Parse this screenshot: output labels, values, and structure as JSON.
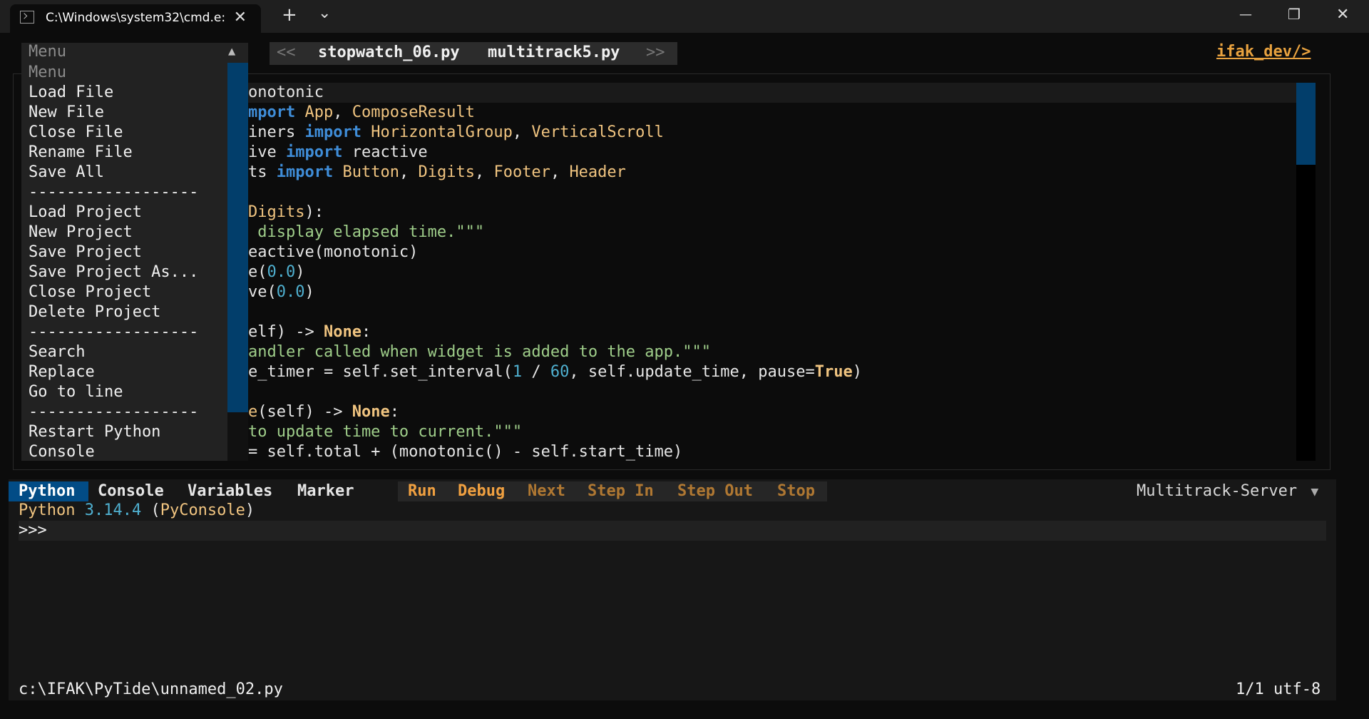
{
  "window": {
    "tab_title": "C:\\Windows\\system32\\cmd.e:",
    "tab_close": "✕",
    "new_tab": "+",
    "dropdown": "⌄",
    "minimize": "—",
    "restore": "❐",
    "close": "✕"
  },
  "menu": {
    "header": "Menu",
    "scroll_up": "▲",
    "items": [
      {
        "label": "Menu",
        "dim": true
      },
      {
        "label": "Load File"
      },
      {
        "label": "New File"
      },
      {
        "label": "Close File"
      },
      {
        "label": "Rename File"
      },
      {
        "label": "Save All"
      },
      {
        "label": "------------------"
      },
      {
        "label": "Load Project"
      },
      {
        "label": "New Project"
      },
      {
        "label": "Save Project"
      },
      {
        "label": "Save Project As..."
      },
      {
        "label": "Close Project"
      },
      {
        "label": "Delete Project"
      },
      {
        "label": "------------------"
      },
      {
        "label": "Search"
      },
      {
        "label": "Replace"
      },
      {
        "label": "Go to line"
      },
      {
        "label": "------------------"
      },
      {
        "label": "Restart Python"
      },
      {
        "label": "Console"
      }
    ]
  },
  "file_tabs": {
    "prev": "<<",
    "tabs": [
      "stopwatch_06.py",
      "multitrack5.py"
    ],
    "next": ">>"
  },
  "brand": "ifak_dev/>",
  "editor": {
    "lines": [
      [
        [
          "onotonic",
          ""
        ]
      ],
      [
        [
          "mport",
          "kw"
        ],
        [
          " ",
          ""
        ],
        [
          "App",
          "cls"
        ],
        [
          ", ",
          ""
        ],
        [
          "ComposeResult",
          "cls"
        ]
      ],
      [
        [
          "iners ",
          ""
        ],
        [
          "import",
          "kw"
        ],
        [
          " ",
          ""
        ],
        [
          "HorizontalGroup",
          "cls"
        ],
        [
          ", ",
          ""
        ],
        [
          "VerticalScroll",
          "cls"
        ]
      ],
      [
        [
          "ive ",
          ""
        ],
        [
          "import",
          "kw"
        ],
        [
          " reactive",
          ""
        ]
      ],
      [
        [
          "ts ",
          ""
        ],
        [
          "import",
          "kw"
        ],
        [
          " ",
          ""
        ],
        [
          "Button",
          "cls"
        ],
        [
          ", ",
          ""
        ],
        [
          "Digits",
          "cls"
        ],
        [
          ", ",
          ""
        ],
        [
          "Footer",
          "cls"
        ],
        [
          ", ",
          ""
        ],
        [
          "Header",
          "cls"
        ]
      ],
      [
        [
          "",
          ""
        ]
      ],
      [
        [
          "Digits",
          "cls"
        ],
        [
          "):",
          ""
        ]
      ],
      [
        [
          " display elapsed time.\"\"\"",
          "str"
        ]
      ],
      [
        [
          "eactive(monotonic)",
          ""
        ]
      ],
      [
        [
          "e(",
          ""
        ],
        [
          "0.0",
          "num"
        ],
        [
          ")",
          ""
        ]
      ],
      [
        [
          "ve(",
          ""
        ],
        [
          "0.0",
          "num"
        ],
        [
          ")",
          ""
        ]
      ],
      [
        [
          "",
          ""
        ]
      ],
      [
        [
          "elf) -> ",
          ""
        ],
        [
          "None",
          "kc"
        ],
        [
          ":",
          ""
        ]
      ],
      [
        [
          "andler called when widget is added to the app.\"\"\"",
          "str"
        ]
      ],
      [
        [
          "e_timer = self.set_interval(",
          ""
        ],
        [
          "1",
          "num"
        ],
        [
          " / ",
          ""
        ],
        [
          "60",
          "num"
        ],
        [
          ", self.update_time, pause=",
          ""
        ],
        [
          "True",
          "kc"
        ],
        [
          ")",
          ""
        ]
      ],
      [
        [
          "",
          ""
        ]
      ],
      [
        [
          "e",
          "cls"
        ],
        [
          "(self) -> ",
          ""
        ],
        [
          "None",
          "kc"
        ],
        [
          ":",
          ""
        ]
      ],
      [
        [
          "to update time to current.\"\"\"",
          "str"
        ]
      ],
      [
        [
          "= self.total + (monotonic() - self.start_time)",
          ""
        ]
      ]
    ]
  },
  "bottom": {
    "tabs": [
      "Python",
      "Console",
      "Variables",
      "Marker"
    ],
    "run_buttons": [
      {
        "label": "Run",
        "enabled": true
      },
      {
        "label": "Debug",
        "enabled": true
      },
      {
        "label": "Next",
        "enabled": false
      },
      {
        "label": "Step In",
        "enabled": false
      },
      {
        "label": "Step Out",
        "enabled": false
      },
      {
        "label": "Stop",
        "enabled": false
      }
    ],
    "server": "Multitrack-Server",
    "server_arrow": "▼",
    "console_line": [
      [
        "Python ",
        "cls"
      ],
      [
        "3.14.4",
        "num"
      ],
      [
        " (",
        ""
      ],
      [
        "PyConsole",
        "cls"
      ],
      [
        ")",
        ""
      ]
    ],
    "prompt": ">>>",
    "input_value": ""
  },
  "status": {
    "path": "c:\\IFAK\\PyTide\\unnamed_02.py",
    "position": "1/1",
    "encoding": "utf-8"
  },
  "colors": {
    "accent_blue": "#024c86",
    "scroll_blue": "#023e6b",
    "brand_orange": "#e8a23f"
  }
}
